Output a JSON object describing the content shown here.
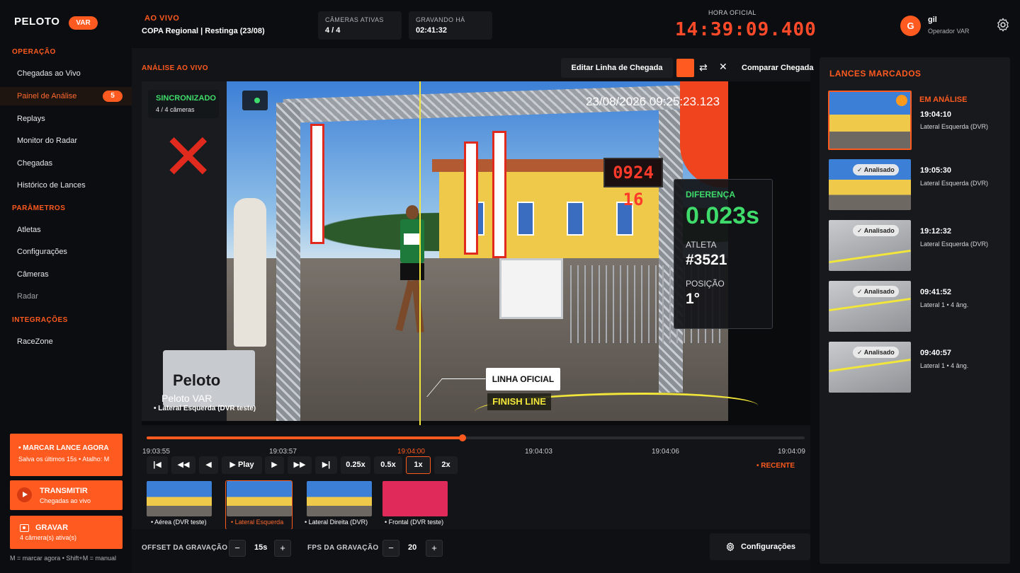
{
  "header": {
    "logo": "PELOTO",
    "badge": "VAR",
    "live_label": "AO VIVO",
    "event": "COPA Regional | Restinga (23/08)",
    "cameras_label": "CÂMERAS ATIVAS",
    "cameras_value": "4 / 4",
    "recording_label": "GRAVANDO HÁ",
    "recording_value": "02:41:32",
    "clock_label": "HORA OFICIAL",
    "clock_value": "14:39:09.400",
    "user_initial": "G",
    "user_name": "gil",
    "user_role": "Operador VAR"
  },
  "sidebar": {
    "operacao_title": "OPERAÇÃO",
    "operacao_items": [
      "Chegadas ao Vivo",
      "Painel de Análise",
      "Replays",
      "Monitor do Radar",
      "Chegadas",
      "Histórico de Lances"
    ],
    "active_badge": "5",
    "parametros_title": "PARÂMETROS",
    "parametros_items": [
      "Atletas",
      "Configurações",
      "Câmeras",
      "Radar"
    ],
    "integracoes_title": "INTEGRAÇÕES",
    "integracoes_items": [
      "RaceZone"
    ],
    "mark_title": "• MARCAR LANCE AGORA",
    "mark_sub": "Salva os últimos 15s • Atalho: M",
    "transmit_title": "TRANSMITIR",
    "transmit_sub": "Chegadas ao vivo",
    "record_title": "GRAVAR",
    "record_sub": "4 câmera(s) ativa(s)",
    "shortcut": "M = marcar agora • Shift+M = manual"
  },
  "main": {
    "panel_title": "ANÁLISE AO VIVO",
    "edit_line": "Editar Linha de Chegada",
    "compare": "Comparar Chegada",
    "video": {
      "timestamp": "23/08/2026 09:25:23.123",
      "sync_title": "SINCRONIZADO",
      "sync_sub": "4 / 4 câmeras",
      "watermark": "Peloto VAR",
      "camera": "• Lateral Esquerda (DVR teste)",
      "diff_label": "DIFERENÇA",
      "diff_value": "0.023s",
      "athlete_label": "ATLETA",
      "athlete_value": "#3521",
      "position_label": "POSIÇÃO",
      "position_value": "1°",
      "line_oficial": "LINHA OFICIAL",
      "finish_line": "FINISH LINE",
      "scene_timer": "0924 16"
    },
    "timeline": {
      "progress": 0.48,
      "ticks": [
        "19:03:55",
        "19:03:57",
        "19:04:00",
        "19:04:03",
        "19:04:06",
        "19:04:09"
      ],
      "current_tick": "19:04:00",
      "play": "▶ Play",
      "speeds": [
        "0.25x",
        "0.5x",
        "1x",
        "2x"
      ],
      "selected_speed": "1x",
      "recent": "• RECENTE"
    },
    "thumbs": [
      {
        "label": "• Aérea (DVR teste)"
      },
      {
        "label": "• Lateral Esquerda"
      },
      {
        "label": "• Lateral Direita (DVR)"
      },
      {
        "label": "• Frontal (DVR teste)"
      }
    ],
    "footer": {
      "offset_label": "OFFSET DA GRAVAÇÃO",
      "offset_value": "15s",
      "fps_label": "FPS DA GRAVAÇÃO",
      "fps_value": "20",
      "minus": "−",
      "plus": "+",
      "config": "Configurações"
    }
  },
  "lances": {
    "title": "LANCES MARCADOS",
    "items": [
      {
        "status": "EM ANÁLISE",
        "time": "19:04:10",
        "desc": "Lateral Esquerda (DVR)",
        "badge": ""
      },
      {
        "status": "",
        "time": "19:05:30",
        "desc": "Lateral Esquerda (DVR)",
        "badge": "✓ Analisado"
      },
      {
        "status": "",
        "time": "19:12:32",
        "desc": "Lateral Esquerda (DVR)",
        "badge": "✓ Analisado"
      },
      {
        "status": "",
        "time": "09:41:52",
        "desc": "Lateral 1 • 4 âng.",
        "badge": "✓ Analisado"
      },
      {
        "status": "",
        "time": "09:40:57",
        "desc": "Lateral 1 • 4 âng.",
        "badge": "✓ Analisado"
      }
    ]
  },
  "colors": {
    "accent": "#ff5a1f",
    "success": "#3fdc6b",
    "finish_line": "#f2e63a"
  }
}
